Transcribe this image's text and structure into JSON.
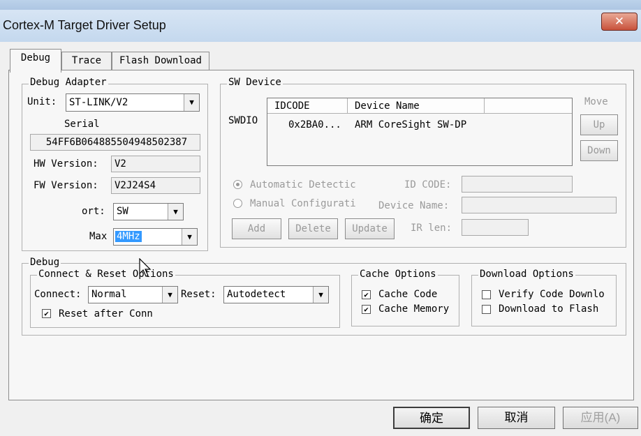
{
  "window": {
    "title": "Cortex-M Target Driver Setup",
    "close_glyph": "✕"
  },
  "tabs": [
    {
      "label": "Debug",
      "active": true
    },
    {
      "label": "Trace",
      "active": false
    },
    {
      "label": "Flash Download",
      "active": false
    }
  ],
  "debug_adapter": {
    "legend": "Debug Adapter",
    "unit_label": "Unit:",
    "unit_value": "ST-LINK/V2",
    "serial_label": "Serial",
    "serial_value": "54FF6B064885504948502387",
    "hw_label": "HW Version:",
    "hw_value": "V2",
    "fw_label": "FW Version:",
    "fw_value": "V2J24S4",
    "port_label": "ort:",
    "port_value": "SW",
    "max_label": "Max",
    "max_value": "4MHz"
  },
  "sw_device": {
    "legend": "SW Device",
    "swdio_label": "SWDIO",
    "columns": [
      "IDCODE",
      "Device Name"
    ],
    "rows": [
      {
        "idcode": "0x2BA0...",
        "device_name": "ARM CoreSight SW-DP"
      }
    ],
    "move_label": "Move",
    "up_label": "Up",
    "down_label": "Down",
    "auto_detect_label": "Automatic Detectic",
    "manual_config_label": "Manual Configurati",
    "add_label": "Add",
    "delete_label": "Delete",
    "update_label": "Update",
    "id_code_label": "ID CODE:",
    "device_name_label": "Device Name:",
    "ir_len_label": "IR len:"
  },
  "debug": {
    "legend": "Debug",
    "connect_reset_legend": "Connect & Reset Options",
    "connect_label": "Connect:",
    "connect_value": "Normal",
    "reset_label": "Reset:",
    "reset_value": "Autodetect",
    "reset_after_conn_label": "Reset after Conn",
    "reset_after_conn_checked": true
  },
  "cache_options": {
    "legend": "Cache Options",
    "cache_code_label": "Cache Code",
    "cache_code_checked": true,
    "cache_memory_label": "Cache Memory",
    "cache_memory_checked": true
  },
  "download_options": {
    "legend": "Download Options",
    "verify_label": "Verify Code Downlo",
    "verify_checked": false,
    "download_flash_label": "Download to Flash",
    "download_flash_checked": false
  },
  "footer": {
    "ok_label": "确定",
    "cancel_label": "取消",
    "apply_label": "应用(A)"
  },
  "icons": {
    "dropdown": "▼",
    "check": "✔"
  }
}
